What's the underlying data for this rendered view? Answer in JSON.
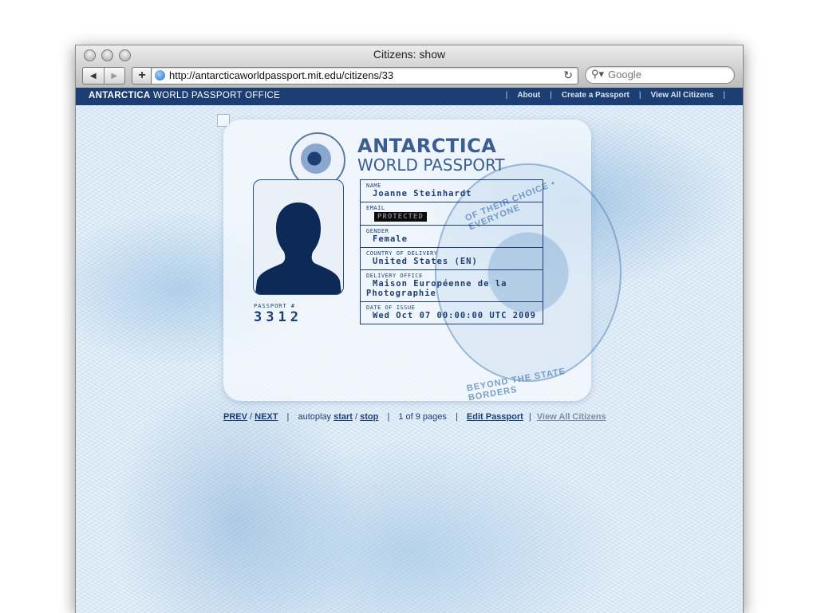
{
  "browser": {
    "window_title": "Citizens: show",
    "url": "http://antarcticaworldpassport.mit.edu/citizens/33",
    "search_placeholder": "Google"
  },
  "site": {
    "brand_bold": "ANTARCTICA",
    "brand_rest": " WORLD PASSPORT OFFICE",
    "nav": [
      {
        "label": "About"
      },
      {
        "label": "Create a Passport"
      },
      {
        "label": "View All Citizens"
      }
    ]
  },
  "passport": {
    "title_line1": "ANTARCTICA",
    "title_line2": "WORLD PASSPORT",
    "seal_text": "OF THEIR CHOICE • EVERYONE",
    "seal_text_bottom": "BEYOND THE STATE BORDERS",
    "passport_label": "PASSPORT #",
    "passport_number": "3312",
    "fields": [
      {
        "label": "NAME",
        "value": "Joanne Steinhardt"
      },
      {
        "label": "EMAIL",
        "value": "PROTECTED",
        "protected": true
      },
      {
        "label": "GENDER",
        "value": "Female"
      },
      {
        "label": "COUNTRY OF DELIVERY",
        "value": "United States (EN)"
      },
      {
        "label": "DELIVERY OFFICE",
        "value": "Maison Européenne de la Photographie"
      },
      {
        "label": "DATE OF ISSUE",
        "value": "Wed Oct 07 00:00:00 UTC 2009"
      }
    ]
  },
  "pager": {
    "prev": "PREV",
    "next": "NEXT",
    "autoplay_label": "autoplay",
    "start": "start",
    "stop": "stop",
    "page_info": "1 of 9 pages",
    "edit": "Edit Passport",
    "view_all": "View All Citizens"
  }
}
